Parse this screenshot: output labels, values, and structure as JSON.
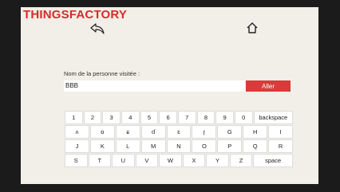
{
  "app": {
    "brand": "THINGSFACTORY"
  },
  "nav": {
    "back_icon": "back-arrow-icon",
    "home_icon": "home-icon"
  },
  "form": {
    "label": "Nom de la personne visitée :",
    "value": "BBB",
    "submit_label": "Aller",
    "accent_color": "#d93a3a"
  },
  "keyboard": {
    "rows": [
      [
        "1",
        "2",
        "3",
        "4",
        "5",
        "6",
        "7",
        "8",
        "9",
        "0",
        "backspace"
      ],
      [
        "ʌ",
        "ɒ",
        "ɕ",
        "ɗ",
        "ɛ",
        "ɼ",
        "G",
        "H",
        "I"
      ],
      [
        "J",
        "K",
        "L",
        "M",
        "N",
        "O",
        "P",
        "Q",
        "R"
      ],
      [
        "S",
        "T",
        "U",
        "V",
        "W",
        "X",
        "Y",
        "Z",
        "space"
      ]
    ]
  }
}
